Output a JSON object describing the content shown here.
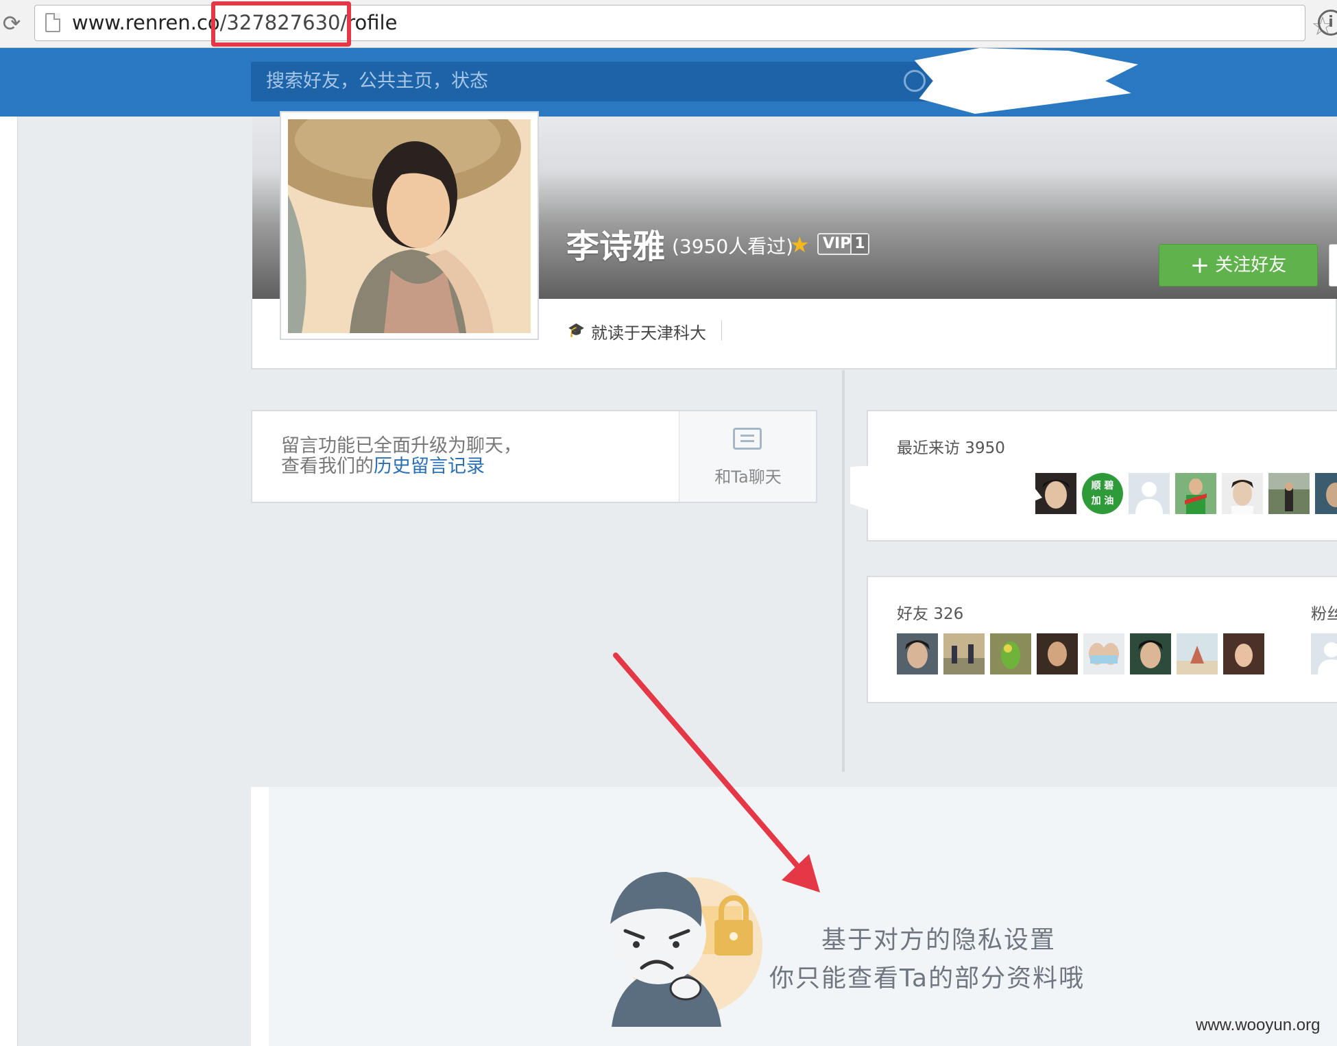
{
  "browser": {
    "url_prefix": "www.renren.co",
    "url_highlighted": "/327827630/",
    "url_suffix": "rofile"
  },
  "nav": {
    "search_placeholder": "搜索好友，公共主页，状态"
  },
  "profile": {
    "name": "李诗雅",
    "visits": "(3950人看过)",
    "vip_label": "VIP",
    "vip_level": "1",
    "follow_label": "关注好友",
    "school": "就读于天津科大"
  },
  "message": {
    "line1": "留言功能已全面升级为聊天，",
    "line2_prefix": "查看我们的",
    "line2_link": "历史留言记录",
    "chat_label": "和Ta聊天"
  },
  "visitors": {
    "title": "最近来访 3950",
    "badge_text": "顺 碧 加 油"
  },
  "friends": {
    "title": "好友 326",
    "fans_title": "粉丝"
  },
  "privacy": {
    "line1": "基于对方的隐私设置",
    "line2": "你只能查看Ta的部分资料哦"
  },
  "watermark": "www.wooyun.org",
  "colors": {
    "nav": "#2a78c2",
    "follow": "#5fb24c",
    "highlight": "#e53846",
    "link": "#2a6fb3"
  }
}
